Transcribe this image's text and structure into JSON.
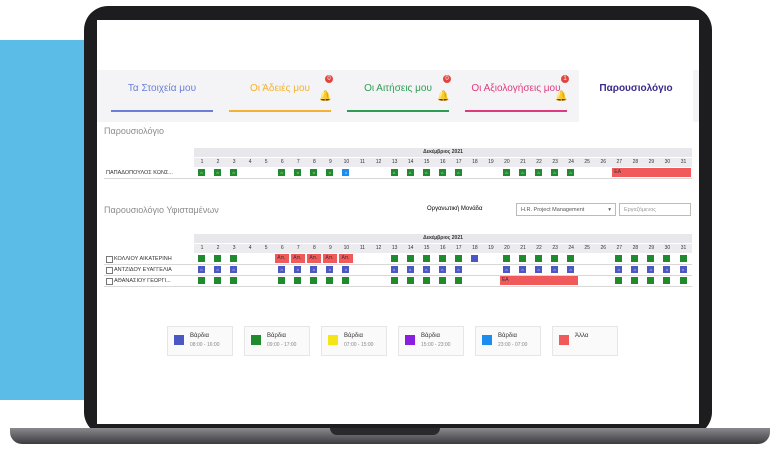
{
  "tabs": [
    {
      "label": "Τα Στοιχεία μου",
      "color": "#6b7fd7",
      "badge": ""
    },
    {
      "label": "Οι Άδειές μου",
      "color": "#f2b233",
      "badge": "0"
    },
    {
      "label": "Οι Αιτήσεις μου",
      "color": "#2e9d54",
      "badge": "0"
    },
    {
      "label": "Οι Αξιολογήσεις μου",
      "color": "#e03a7e",
      "badge": "1"
    },
    {
      "label": "Παρουσιολόγιο",
      "color": "#3b2a8c",
      "badge": "",
      "active": true
    }
  ],
  "section1_title": "Παρουσιολόγιο",
  "month_label": "Δεκέμβριος 2021",
  "days": [
    "1",
    "2",
    "3",
    "4",
    "5",
    "6",
    "7",
    "8",
    "9",
    "10",
    "11",
    "12",
    "13",
    "14",
    "15",
    "16",
    "17",
    "18",
    "19",
    "20",
    "21",
    "22",
    "23",
    "24",
    "25",
    "26",
    "27",
    "28",
    "29",
    "30",
    "31"
  ],
  "my_row": {
    "name": "ΠΑΠΑΔΟΠΟΥΛΟΣ ΚΩΝΣ...",
    "red_label": "ΕΑ"
  },
  "section2_title": "Παρουσιολόγιο Υφισταμένων",
  "filter_label": "Οργανωτική Μονάδα",
  "filter_value": "H.R. Project Management",
  "employee_placeholder": "Εργαζόμενος",
  "sub_rows": [
    {
      "name": "ΚΟΛΛΙΟΥ ΑΙΚΑΤΕΡΙΝΗ",
      "leave_label": "Απ."
    },
    {
      "name": "ΑΝΤΖΙΔΟΥ ΕΥΑΓΓΕΛΙΑ"
    },
    {
      "name": "ΑΘΑΝΑΣΙΟΥ ΓΕΩΡΓΙ...",
      "red_label": "ΕΑ"
    }
  ],
  "legend": [
    {
      "title": "Βάρδια",
      "hours": "08:00 - 16:00",
      "color": "#4b57c2"
    },
    {
      "title": "Βάρδια",
      "hours": "09:00 - 17:00",
      "color": "#1f8a2e"
    },
    {
      "title": "Βάρδια",
      "hours": "07:00 - 15:00",
      "color": "#f5e418"
    },
    {
      "title": "Βάρδια",
      "hours": "15:00 - 23:00",
      "color": "#8a1fe0"
    },
    {
      "title": "Βάρδια",
      "hours": "23:00 - 07:00",
      "color": "#1c8df0"
    },
    {
      "title": "Άλλα",
      "hours": "",
      "color": "#f05a5a"
    }
  ]
}
